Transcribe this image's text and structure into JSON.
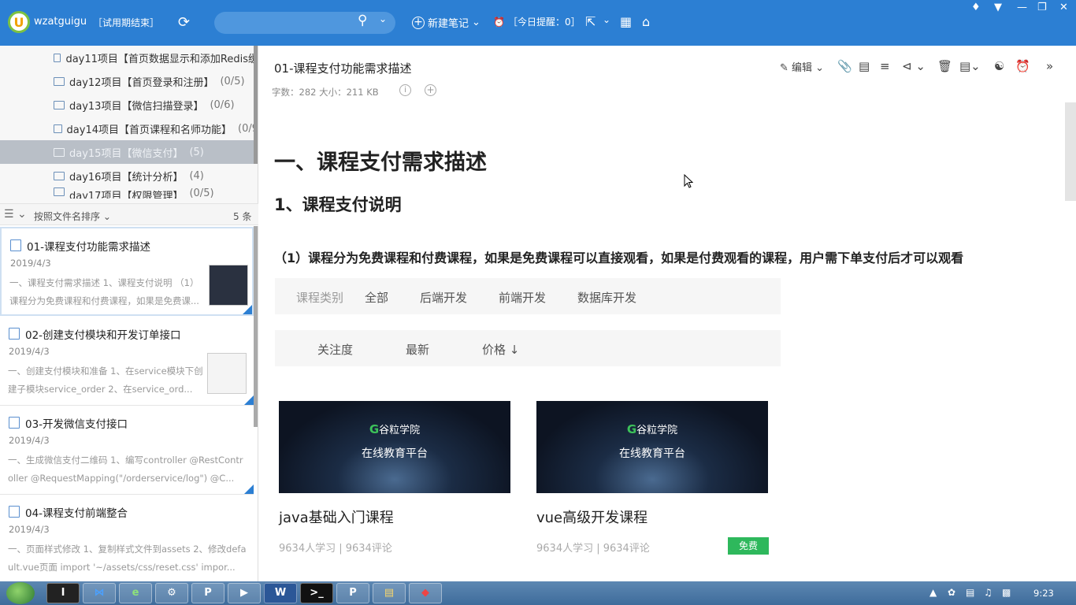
{
  "topbar": {
    "username": "wzatguigu",
    "trial": "［试用期结束］",
    "new_note": "新建笔记",
    "reminder": "［今日提醒：0］"
  },
  "tree": {
    "items": [
      {
        "label": "day11项目【首页数据显示和添加Redis缓",
        "count": ""
      },
      {
        "label": "day12项目【首页登录和注册】",
        "count": "(0/5)"
      },
      {
        "label": "day13项目【微信扫描登录】",
        "count": "(0/6)"
      },
      {
        "label": "day14项目【首页课程和名师功能】",
        "count": "(0/9"
      },
      {
        "label": "day15项目【微信支付】",
        "count": "(5)"
      },
      {
        "label": "day16项目【统计分析】",
        "count": "(4)"
      },
      {
        "label": "day17项目【权限管理】",
        "count": "(0/5)"
      }
    ]
  },
  "sortbar": {
    "label": "按照文件名排序",
    "count": "5 条"
  },
  "notes": [
    {
      "title": "01-课程支付功能需求描述",
      "date": "2019/4/3",
      "snippet": "一、课程支付需求描述 1、课程支付说明 （1）课程分为免费课程和付费课程，如果是免费课..."
    },
    {
      "title": "02-创建支付模块和开发订单接口",
      "date": "2019/4/3",
      "snippet": "一、创建支付模块和准备 1、在service模块下创建子模块service_order 2、在service_ord..."
    },
    {
      "title": "03-开发微信支付接口",
      "date": "2019/4/3",
      "snippet": "一、生成微信支付二维码 1、编写controller @RestController @RequestMapping(\"/orderservice/log\") @C..."
    },
    {
      "title": "04-课程支付前端整合",
      "date": "2019/4/3",
      "snippet": "一、页面样式修改 1、复制样式文件到assets 2、修改default.vue页面 import '~/assets/css/reset.css' impor..."
    }
  ],
  "editor": {
    "title": "01-课程支付功能需求描述",
    "meta": "字数：282    大小：211 KB",
    "edit_label": "编辑",
    "h1": "一、课程支付需求描述",
    "h2": "1、课程支付说明",
    "h3": "（1）课程分为免费课程和付费课程，如果是免费课程可以直接观看，如果是付费观看的课程，用户需下单支付后才可以观看"
  },
  "course": {
    "category_label": "课程类别",
    "categories": [
      "全部",
      "后端开发",
      "前端开发",
      "数据库开发"
    ],
    "sorts": [
      "关注度",
      "最新",
      "价格 ↓"
    ],
    "cards": [
      {
        "brand": "谷粒学院",
        "slogan": "在线教育平台",
        "name": "java基础入门课程",
        "stats": "9634人学习 | 9634评论"
      },
      {
        "brand": "谷粒学院",
        "slogan": "在线教育平台",
        "name": "vue高级开发课程",
        "stats": "9634人学习 | 9634评论",
        "badge": "免费"
      }
    ]
  },
  "taskbar": {
    "time": "9:23"
  },
  "colors": {
    "accent": "#2c7fd3",
    "free_badge": "#2eb85c"
  }
}
